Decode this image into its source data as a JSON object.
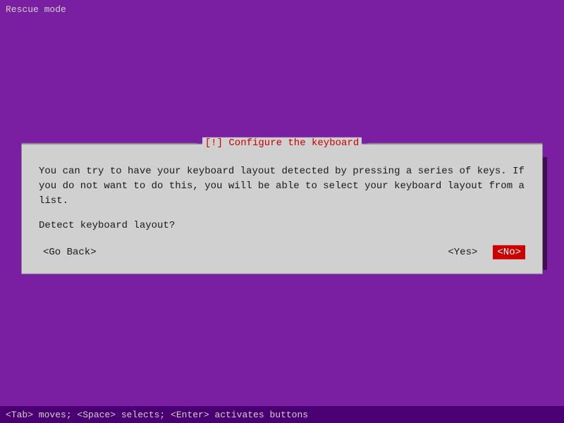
{
  "titleBar": {
    "text": "Rescue mode"
  },
  "dialog": {
    "title": "[!] Configure the keyboard",
    "body": "You can try to have your keyboard layout detected by pressing a series of keys. If you do not want to do this, you will be able to select your keyboard layout from a list.",
    "question": "Detect keyboard layout?",
    "buttons": {
      "goBack": "<Go Back>",
      "yes": "<Yes>",
      "no": "<No>"
    }
  },
  "statusBar": {
    "text": "<Tab> moves; <Space> selects; <Enter> activates buttons"
  }
}
